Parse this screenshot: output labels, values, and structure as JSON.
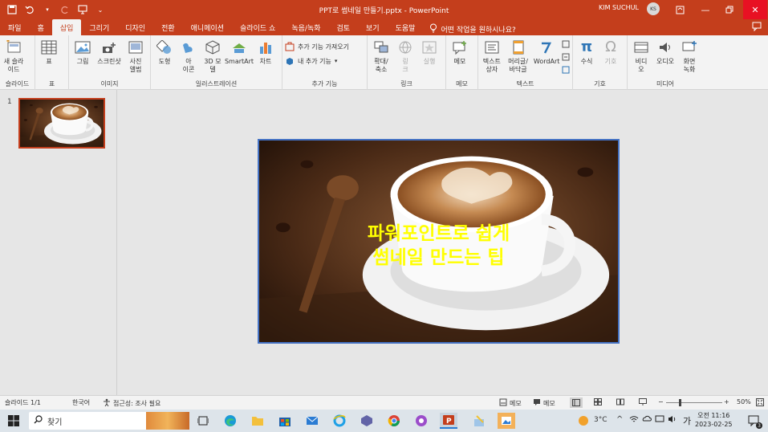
{
  "titlebar": {
    "doc_title": "PPT로 썸네일 만들기.pptx  -  PowerPoint",
    "user_name": "KIM SUCHUL",
    "avatar_initials": "KS"
  },
  "menu": {
    "tabs": [
      "파일",
      "홈",
      "삽입",
      "그리기",
      "디자인",
      "전환",
      "애니메이션",
      "슬라이드 쇼",
      "녹음/녹화",
      "검토",
      "보기",
      "도움말"
    ],
    "tell_me": "어떤 작업을 원하시나요?"
  },
  "ribbon": {
    "new_slide": "새 슬라\n이드",
    "group_slides": "슬라이드",
    "table": "표",
    "group_table": "표",
    "picture": "그림",
    "screenshot": "스크린샷",
    "album": "사진\n앨범",
    "group_images": "이미지",
    "shapes": "도형",
    "icons": "아\n이콘",
    "models3d": "3D 모\n델",
    "smartart": "SmartArt",
    "chart": "차트",
    "group_illustrations": "일러스트레이션",
    "get_addins": "추가 기능 가져오기",
    "my_addins": "내 추가 기능",
    "group_addins": "추가 기능",
    "zoom": "확대/\n축소",
    "link": "링\n크",
    "action": "실행",
    "group_links": "링크",
    "comment": "메모",
    "group_comments": "메모",
    "textbox": "텍스트\n상자",
    "header_footer": "머리글/\n바닥글",
    "wordart": "WordArt",
    "group_text": "텍스트",
    "equation": "수식",
    "symbol": "기호",
    "group_symbols": "기호",
    "video": "비디\n오",
    "audio": "오디오",
    "screen_rec": "화면\n녹화",
    "group_media": "미디어"
  },
  "thumbs": {
    "number": "1"
  },
  "slide": {
    "title_line1": "파워포인트로 쉽게",
    "title_line2": "썸네일 만드는 팁"
  },
  "status": {
    "slide_count": "슬라이드 1/1",
    "language": "한국어",
    "accessibility": "접근성: 조사 필요",
    "notes_btn": "메모",
    "comments_btn": "메모",
    "zoom": "50%"
  },
  "taskbar": {
    "search": "찾기",
    "weather": "3°C",
    "ime": "가",
    "time_ampm": "오전 11:16",
    "date": "2023-02-25",
    "notif_count": "3"
  },
  "colors": {
    "accent": "#c43e1c",
    "slide_title": "#ffff00",
    "slide_border": "#4472c4"
  }
}
